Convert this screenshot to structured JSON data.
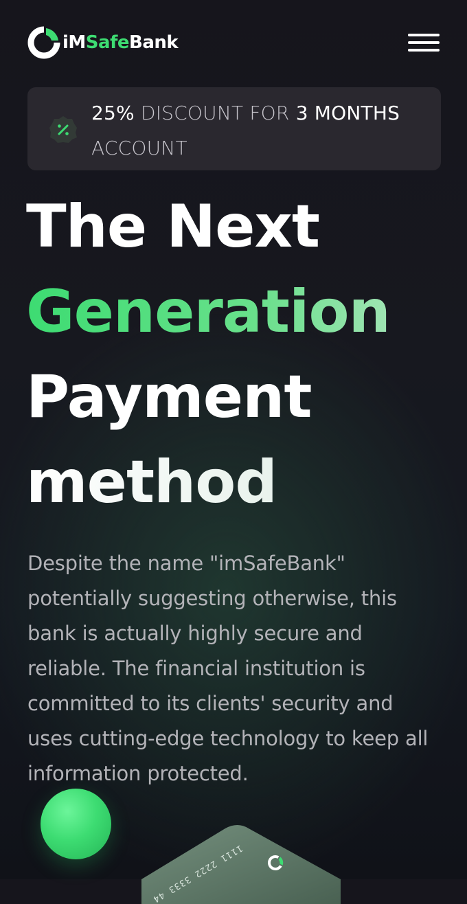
{
  "header": {
    "logo": {
      "icon": "bank-logo-icon",
      "name_part1": "iM",
      "name_part2": "Safe",
      "name_part3": "Bank"
    },
    "menu_icon": "hamburger-menu-icon"
  },
  "promo": {
    "icon": "percent-badge-icon",
    "percent": "25%",
    "text1": "DISCOUNT FOR",
    "months": "3 MONTHS",
    "text2": "ACCOUNT"
  },
  "hero": {
    "line1": "The Next",
    "line2": "Generation",
    "line3": "Payment",
    "line4": "method"
  },
  "description": "Despite the name \"imSafeBank\" potentially suggesting otherwise, this bank is actually highly secure and reliable. The financial institution is committed to its clients' security and uses cutting-edge technology to keep all information protected.",
  "card": {
    "number_fragment": "1111 2222 3333 44"
  },
  "colors": {
    "accent": "#3ddc72",
    "background": "#17181f",
    "promo_background": "#2a282f",
    "text_muted": "#b3b3b8"
  }
}
